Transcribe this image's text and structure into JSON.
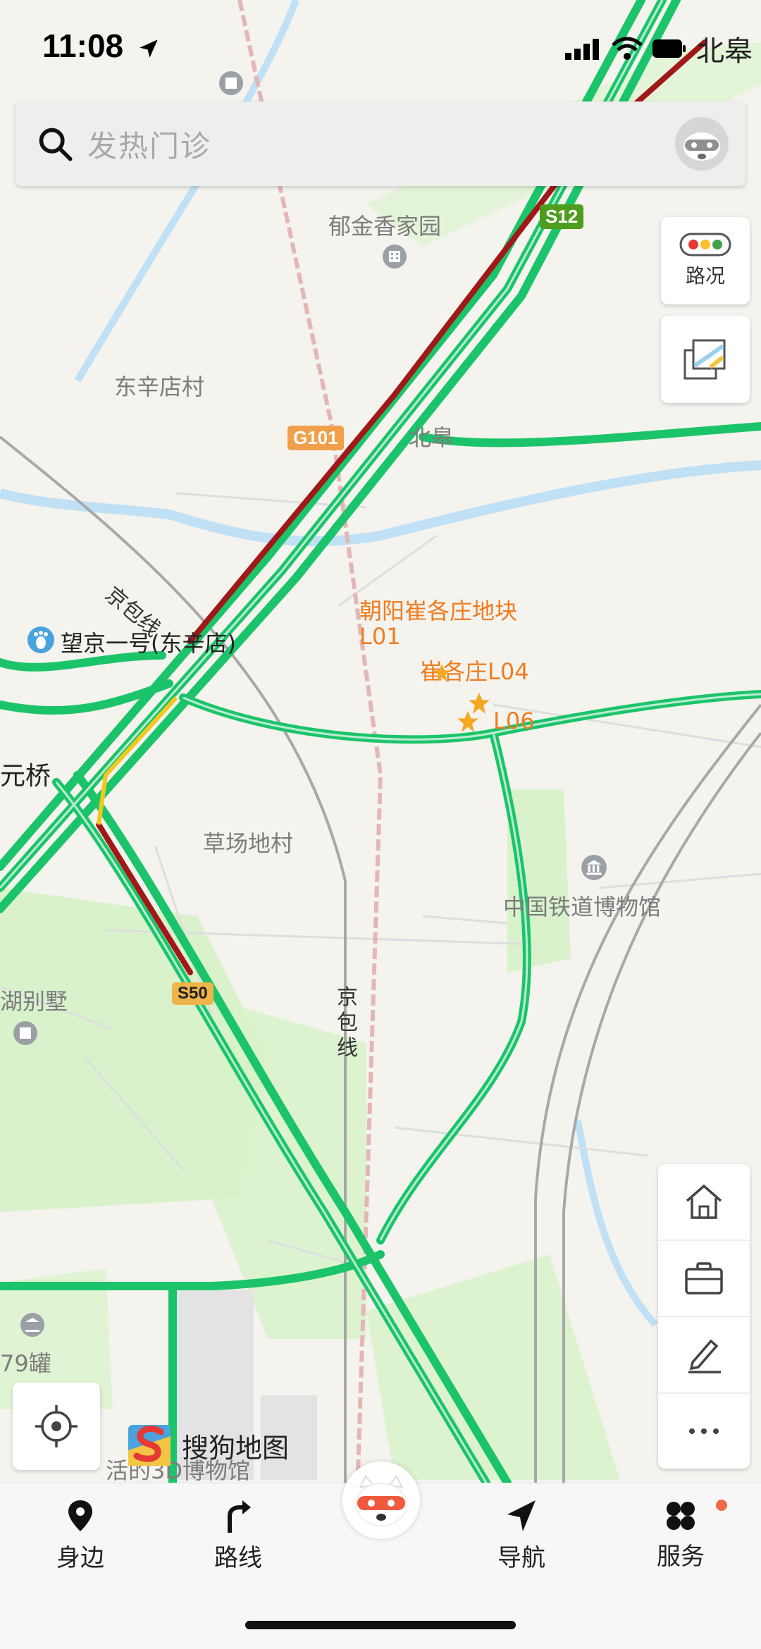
{
  "status": {
    "time": "11:08",
    "location_text": "北皋"
  },
  "search": {
    "placeholder": "发热门诊"
  },
  "map_controls": {
    "traffic_label": "路况"
  },
  "map_labels": {
    "yujinxiang": "郁金香家园",
    "dongxindian": "东辛店村",
    "beigao": "北皋",
    "jingbao_line_1": "京包线",
    "wangjing": "望京一号(东辛店)",
    "chaoyang_plot_line1": "朝阳崔各庄地块",
    "chaoyang_plot_line2": "L01",
    "cuigezhuang_l04": "崔各庄L04",
    "l06": "L06",
    "yuanqiao": "元桥",
    "caochangdi": "草场地村",
    "railway_museum": "中国铁道博物馆",
    "hu_villa": "湖别墅",
    "jingbao_line_2": "京包线",
    "guan_79": "79罐",
    "museum_3d": "活的3D博物馆"
  },
  "road_shields": {
    "s12": "S12",
    "g101": "G101",
    "s50": "S50"
  },
  "brand": {
    "name": "搜狗地图"
  },
  "tabs": [
    {
      "label": "身边",
      "icon": "location-pin-icon"
    },
    {
      "label": "路线",
      "icon": "route-turn-icon"
    },
    {
      "label": "导航",
      "icon": "navigation-arrow-icon"
    },
    {
      "label": "服务",
      "icon": "service-grid-icon"
    }
  ],
  "colors": {
    "road_green": "#1bc46a",
    "road_red": "#a01818",
    "shield_orange": "#f0a04a",
    "shield_green": "#4e9d1f",
    "poi_orange": "#f07c1e"
  }
}
